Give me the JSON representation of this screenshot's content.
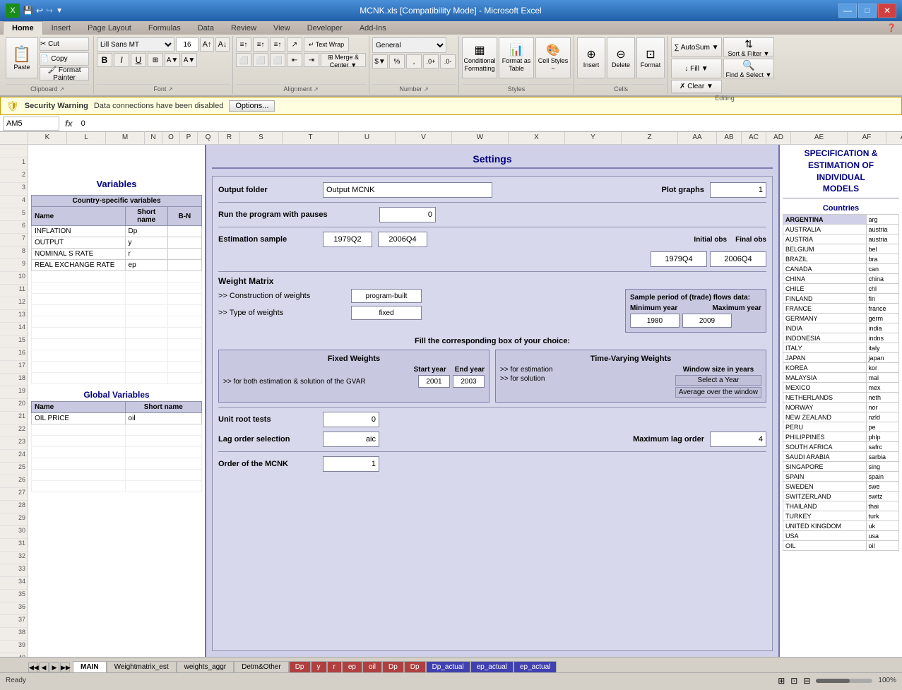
{
  "titleBar": {
    "title": "MCNK.xls [Compatibility Mode] - Microsoft Excel",
    "minimizeBtn": "—",
    "maximizeBtn": "□",
    "closeBtn": "✕"
  },
  "quickAccess": {
    "saveIcon": "💾",
    "undoIcon": "↩",
    "redoIcon": "↪",
    "moreIcon": "▼"
  },
  "ribbon": {
    "tabs": [
      "Home",
      "Insert",
      "Page Layout",
      "Formulas",
      "Data",
      "Review",
      "View",
      "Developer",
      "Add-Ins"
    ],
    "activeTab": "Home",
    "groups": {
      "clipboard": {
        "label": "Clipboard",
        "pasteLabel": "Paste",
        "cutLabel": "Cut",
        "copyLabel": "Copy",
        "formatPainterLabel": "Format Painter"
      },
      "font": {
        "label": "Font",
        "fontName": "Lill Sans MT",
        "fontSize": "16",
        "boldLabel": "B",
        "italicLabel": "I",
        "underlineLabel": "U"
      },
      "alignment": {
        "label": "Alignment",
        "wrapTextLabel": "Text Wrap",
        "mergeCenterLabel": "Merge & Center"
      },
      "number": {
        "label": "Number",
        "formatLabel": "General"
      },
      "styles": {
        "label": "Styles",
        "conditionalLabel": "Conditional Formatting",
        "formatTableLabel": "Format as Table",
        "cellStylesLabel": "Cell Styles"
      },
      "cells": {
        "label": "Cells",
        "insertLabel": "Insert",
        "deleteLabel": "Delete",
        "formatLabel": "Format"
      },
      "editing": {
        "label": "Editing",
        "autosumLabel": "AutoSum",
        "fillLabel": "Fill",
        "clearLabel": "Clear",
        "sortFilterLabel": "Sort & Filter",
        "findSelectLabel": "Find & Select"
      }
    }
  },
  "securityWarning": {
    "icon": "🛡",
    "text": "Security Warning   Data connections have been disabled",
    "optionsLabel": "Options..."
  },
  "formulaBar": {
    "cellRef": "AM5",
    "value": "0"
  },
  "worksheet": {
    "leftPanel": {
      "title": "Variables",
      "countrySpecificTitle": "Country-specific variables",
      "tableHeaders": [
        "Name",
        "Short name",
        "B-N"
      ],
      "variables": [
        {
          "name": "INFLATION",
          "short": "Dp",
          "bn": ""
        },
        {
          "name": "OUTPUT",
          "short": "y",
          "bn": ""
        },
        {
          "name": "NOMINAL S RATE",
          "short": "r",
          "bn": ""
        },
        {
          "name": "REAL EXCHANGE RATE",
          "short": "ep",
          "bn": ""
        }
      ],
      "globalTitle": "Global Variables",
      "globalHeaders": [
        "Name",
        "Short name"
      ],
      "globalVars": [
        {
          "name": "OIL PRICE",
          "short": "oil"
        }
      ]
    },
    "mainPanel": {
      "settingsTitle": "Settings",
      "outputFolderLabel": "Output folder",
      "outputFolderValue": "Output MCNK",
      "plotGraphsLabel": "Plot graphs",
      "plotGraphsValue": "1",
      "runPauseLabel": "Run the program with pauses",
      "runPauseValue": "0",
      "estimationLabel": "Estimation sample",
      "estStart": "1979Q2",
      "estEnd": "2006Q4",
      "initialObsLabel": "Initial obs",
      "finalObsLabel": "Final obs",
      "initialObsValue": "1979Q4",
      "finalObsValue": "2006Q4",
      "weightMatrixLabel": "Weight Matrix",
      "constructionLabel": ">> Construction of weights",
      "constructionValue": "program-built",
      "typeLabel": ">> Type of weights",
      "typeValue": "fixed",
      "samplePeriodLabel": "Sample period of (trade) flows data:",
      "minYearLabel": "Minimum year",
      "maxYearLabel": "Maximum year",
      "minYearValue": "1980",
      "maxYearValue": "2009",
      "fillBoxLabel": "Fill the corresponding box of your choice:",
      "fixedWeightsTitle": "Fixed Weights",
      "forBothLabel": ">> for both estimation & solution of the GVAR",
      "startYearLabel": "Start year",
      "endYearLabel": "End year",
      "startYearValue": "2001",
      "endYearValue": "2003",
      "timeVaryingTitle": "Time-Varying Weights",
      "forEstimationLabel": ">> for estimation",
      "forSolutionLabel": ">> for solution",
      "windowSizeLabel": "Window size in years",
      "selectYearLabel": "Select a Year",
      "averageLabel": "Average over the window",
      "unitRootLabel": "Unit root tests",
      "unitRootValue": "0",
      "lagOrderLabel": "Lag order selection",
      "lagOrderValue": "aic",
      "maxLagLabel": "Maximum lag order",
      "maxLagValue": "4",
      "mcnkOrderLabel": "Order of the MCNK",
      "mcnkOrderValue": "1"
    },
    "rightPanel": {
      "specTitle": "SPECIFICATION &\nESTIMATION OF\nINDIVIDUAL\nMODELS",
      "countriesTitle": "Countries",
      "countries": [
        {
          "name": "ARGENTINA",
          "code": "arg"
        },
        {
          "name": "AUSTRALIA",
          "code": "austria"
        },
        {
          "name": "AUSTRIA",
          "code": "austria"
        },
        {
          "name": "BELGIUM",
          "code": "bel"
        },
        {
          "name": "BRAZIL",
          "code": "bra"
        },
        {
          "name": "CANADA",
          "code": "can"
        },
        {
          "name": "CHINA",
          "code": "china"
        },
        {
          "name": "CHILE",
          "code": "chl"
        },
        {
          "name": "FINLAND",
          "code": "fin"
        },
        {
          "name": "FRANCE",
          "code": "france"
        },
        {
          "name": "GERMANY",
          "code": "germ"
        },
        {
          "name": "INDIA",
          "code": "india"
        },
        {
          "name": "INDONESIA",
          "code": "indns"
        },
        {
          "name": "ITALY",
          "code": "italy"
        },
        {
          "name": "JAPAN",
          "code": "japan"
        },
        {
          "name": "KOREA",
          "code": "kor"
        },
        {
          "name": "MALAYSIA",
          "code": "mal"
        },
        {
          "name": "MEXICO",
          "code": "mex"
        },
        {
          "name": "NETHERLANDS",
          "code": "neth"
        },
        {
          "name": "NORWAY",
          "code": "nor"
        },
        {
          "name": "NEW ZEALAND",
          "code": "nzld"
        },
        {
          "name": "PERU",
          "code": "pe"
        },
        {
          "name": "PHILIPPINES",
          "code": "phlp"
        },
        {
          "name": "SOUTH AFRICA",
          "code": "safrc"
        },
        {
          "name": "SAUDI ARABIA",
          "code": "sarbia"
        },
        {
          "name": "SINGAPORE",
          "code": "sing"
        },
        {
          "name": "SPAIN",
          "code": "spain"
        },
        {
          "name": "SWEDEN",
          "code": "swe"
        },
        {
          "name": "SWITZERLAND",
          "code": "switz"
        },
        {
          "name": "THAILAND",
          "code": "thai"
        },
        {
          "name": "TURKEY",
          "code": "turk"
        },
        {
          "name": "UNITED KINGDOM",
          "code": "uk"
        },
        {
          "name": "USA",
          "code": "usa"
        },
        {
          "name": "OIL",
          "code": "oil"
        }
      ]
    }
  },
  "sheetTabs": [
    "MAIN",
    "Weightmatrix_est",
    "weights_aggr",
    "Detm&Other",
    "Dp",
    "y",
    "r",
    "ep",
    "oil",
    "Dp",
    "Dp",
    "Dp_actual",
    "ep_actual",
    "ep_actual"
  ],
  "activeTab": "MAIN",
  "statusBar": {
    "ready": "Ready",
    "zoom": "100%"
  },
  "columnHeaders": [
    "K",
    "L",
    "M",
    "N",
    "O",
    "P",
    "Q",
    "R",
    "S",
    "T",
    "U",
    "V",
    "W",
    "X",
    "Y",
    "Z",
    "AA",
    "AB",
    "AC",
    "AD",
    "AE",
    "AF",
    "AG"
  ]
}
